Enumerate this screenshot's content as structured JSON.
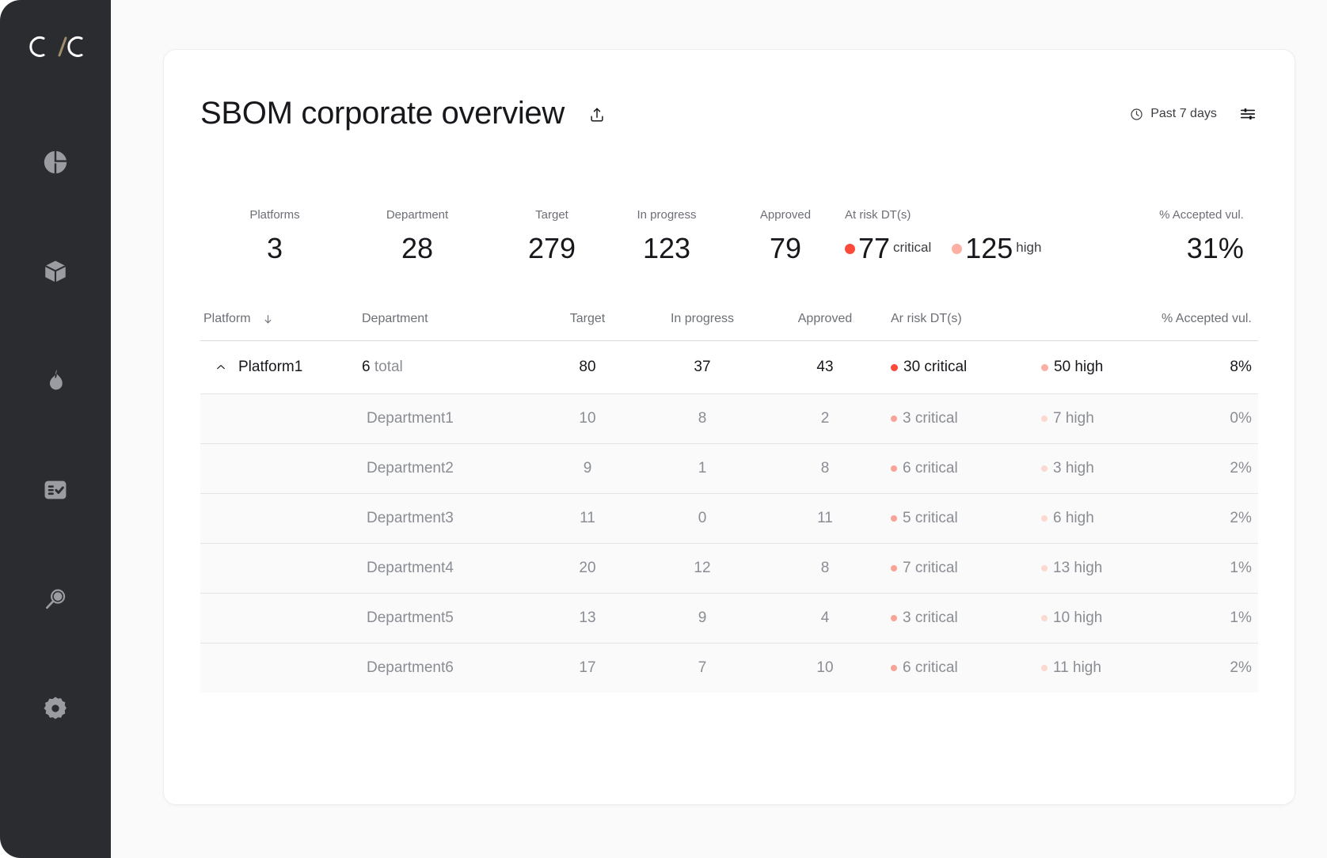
{
  "sidebar": {
    "logo": {
      "name": "C/C",
      "left": "C",
      "slash": "/",
      "right": "C",
      "slash_color": "#a08b6d"
    },
    "items": [
      {
        "name": "pie-chart-icon",
        "label": "Dashboard"
      },
      {
        "name": "cube-icon",
        "label": "Components"
      },
      {
        "name": "flame-icon",
        "label": "Risk"
      },
      {
        "name": "checklist-icon",
        "label": "Tasks"
      },
      {
        "name": "search-icon",
        "label": "Search"
      },
      {
        "name": "gear-icon",
        "label": "Settings"
      }
    ]
  },
  "header": {
    "title": "SBOM corporate overview",
    "share_icon": "share-icon",
    "date_range": "Past 7 days",
    "clock_icon": "clock-icon",
    "filter_icon": "sliders-icon"
  },
  "kpis": [
    {
      "label": "Platforms",
      "value": "3"
    },
    {
      "label": "Department",
      "value": "28"
    },
    {
      "label": "Target",
      "value": "279"
    },
    {
      "label": "In progress",
      "value": "123"
    },
    {
      "label": "Approved",
      "value": "79"
    },
    {
      "label": "At risk DT(s)",
      "critical": "77",
      "critical_suffix": "critical",
      "high": "125",
      "high_suffix": "high"
    },
    {
      "label": "% Accepted vul.",
      "value": "31%"
    }
  ],
  "table": {
    "columns": {
      "platform": "Platform",
      "department": "Department",
      "target": "Target",
      "in_progress": "In progress",
      "approved": "Approved",
      "at_risk": "Ar risk DT(s)",
      "accepted": "% Accepted vul."
    },
    "sort_icon": "arrow-down-icon",
    "rows": [
      {
        "expanded": true,
        "chevron_icon": "chevron-up-icon",
        "platform": "Platform1",
        "department_count": "6",
        "department_suffix": "total",
        "target": "80",
        "in_progress": "37",
        "approved": "43",
        "critical": "30 critical",
        "high": "50 high",
        "accepted": "8%",
        "children": [
          {
            "department": "Department1",
            "target": "10",
            "in_progress": "8",
            "approved": "2",
            "critical": "3 critical",
            "high": "7 high",
            "accepted": "0%"
          },
          {
            "department": "Department2",
            "target": "9",
            "in_progress": "1",
            "approved": "8",
            "critical": "6 critical",
            "high": "3 high",
            "accepted": "2%"
          },
          {
            "department": "Department3",
            "target": "11",
            "in_progress": "0",
            "approved": "11",
            "critical": "5 critical",
            "high": "6 high",
            "accepted": "2%"
          },
          {
            "department": "Department4",
            "target": "20",
            "in_progress": "12",
            "approved": "8",
            "critical": "7 critical",
            "high": "13 high",
            "accepted": "1%"
          },
          {
            "department": "Department5",
            "target": "13",
            "in_progress": "9",
            "approved": "4",
            "critical": "3 critical",
            "high": "10 high",
            "accepted": "1%"
          },
          {
            "department": "Department6",
            "target": "17",
            "in_progress": "7",
            "approved": "10",
            "critical": "6 critical",
            "high": "11 high",
            "accepted": "2%"
          }
        ]
      }
    ]
  },
  "colors": {
    "critical": "#fb4a3a",
    "critical_muted": "#f8a396",
    "high": "#fcb0a4",
    "high_muted": "#fbd9d1",
    "sidebar_bg": "#2b2c30",
    "icon": "#9a9ca1"
  }
}
